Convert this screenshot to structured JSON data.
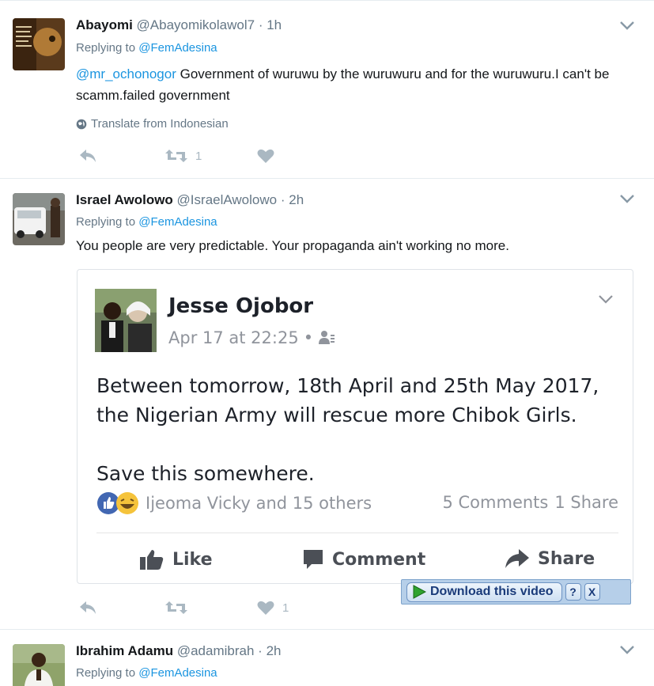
{
  "tweets": [
    {
      "name": "Abayomi",
      "handle": "@Abayomikolawol7",
      "separator": "·",
      "time": "1h",
      "replying_prefix": "Replying to",
      "replying_to": "@FemAdesina",
      "mention": "@mr_ochonogor",
      "text": "Government of wuruwu by the wuruwuru and for the wuruwuru.I can't be scamm.failed government",
      "translate": "Translate from Indonesian",
      "retweets": "1",
      "likes": ""
    },
    {
      "name": "Israel Awolowo",
      "handle": "@IsraelAwolowo",
      "separator": "·",
      "time": "2h",
      "replying_prefix": "Replying to",
      "replying_to": "@FemAdesina",
      "text": "You people are very predictable. Your propaganda ain't working no more.",
      "retweets": "",
      "likes": "1"
    },
    {
      "name": "Ibrahim Adamu",
      "handle": "@adamibrah",
      "separator": "·",
      "time": "2h",
      "replying_prefix": "Replying to",
      "replying_to": "@FemAdesina"
    }
  ],
  "embed": {
    "author": "Jesse Ojobor",
    "date": "Apr 17 at 22:25",
    "separator": "•",
    "line1": "Between tomorrow, 18th April  and 25th May 2017,",
    "line2": "the Nigerian Army will rescue more Chibok Girls.",
    "line3": "Save this somewhere.",
    "reactions": "Ijeoma Vicky and 15 others",
    "comments": "5 Comments",
    "shares": "1 Share",
    "like_label": "Like",
    "comment_label": "Comment",
    "share_label": "Share"
  },
  "download": {
    "label": "Download this video",
    "help": "?",
    "close": "X"
  },
  "colors": {
    "link": "#1b95e0",
    "muted": "#657786",
    "action": "#aab8c2",
    "fb_blue": "#4267b2"
  },
  "icons": [
    "reply-icon",
    "retweet-icon",
    "heart-icon",
    "globe-icon",
    "chevron-down-icon",
    "audience-icon",
    "thumbs-up-icon",
    "comment-icon",
    "share-arrow-icon",
    "play-icon"
  ]
}
